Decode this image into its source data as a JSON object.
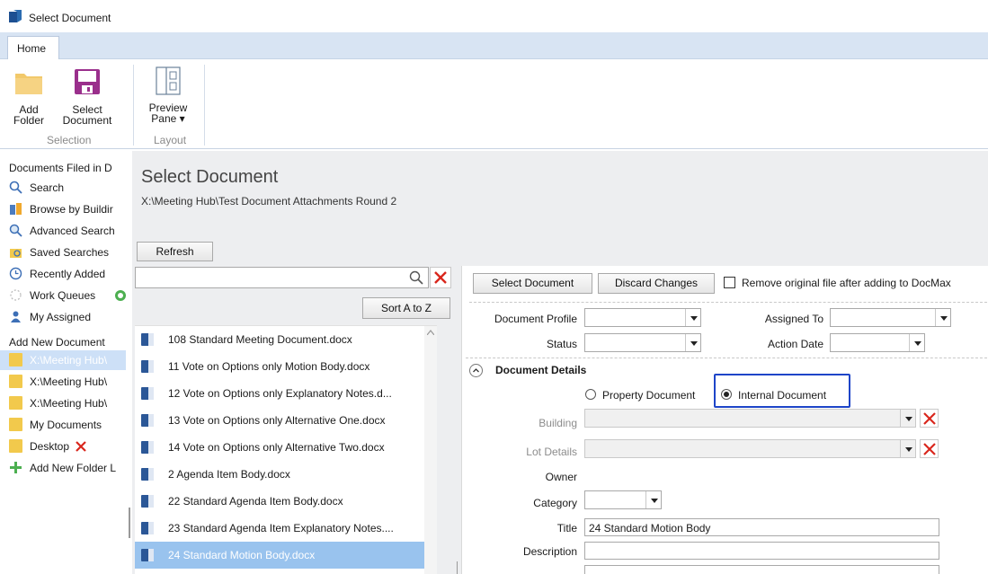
{
  "window": {
    "title": "Select Document"
  },
  "ribbon": {
    "tab": "Home",
    "add_folder": [
      "Add",
      "Folder"
    ],
    "select_document": [
      "Select",
      "Document"
    ],
    "preview_pane": [
      "Preview",
      "Pane ▾"
    ],
    "group_selection": "Selection",
    "group_layout": "Layout"
  },
  "nav": {
    "section_filed": "Documents Filed in D",
    "items": [
      {
        "label": "Search",
        "icon": "search-icon"
      },
      {
        "label": "Browse by Buildir",
        "icon": "building-icon"
      },
      {
        "label": "Advanced Search",
        "icon": "advanced-search-icon"
      },
      {
        "label": "Saved Searches",
        "icon": "saved-search-icon"
      },
      {
        "label": "Recently Added",
        "icon": "clock-icon"
      },
      {
        "label": "Work Queues",
        "icon": "queue-icon"
      },
      {
        "label": "My Assigned",
        "icon": "user-icon"
      }
    ],
    "section_add": "Add New Document",
    "folders": [
      {
        "label": "X:\\Meeting Hub\\",
        "selected": true
      },
      {
        "label": "X:\\Meeting Hub\\"
      },
      {
        "label": "X:\\Meeting Hub\\"
      },
      {
        "label": "My Documents"
      },
      {
        "label": "Desktop"
      }
    ],
    "add_folder_link": "Add New Folder L"
  },
  "main": {
    "heading": "Select Document",
    "path": "X:\\Meeting Hub\\Test Document Attachments Round 2",
    "refresh": "Refresh",
    "search_value": "",
    "sort": "Sort A to Z"
  },
  "documents": [
    "108 Standard Meeting Document.docx",
    "11 Vote on Options only Motion Body.docx",
    "12 Vote on Options only Explanatory Notes.d...",
    "13 Vote on Options only Alternative One.docx",
    "14 Vote on Options only Alternative Two.docx",
    "2 Agenda Item Body.docx",
    "22 Standard Agenda Item Body.docx",
    "23 Standard Agenda Item Explanatory Notes....",
    "24 Standard Motion Body.docx"
  ],
  "selected_document_index": 8,
  "detail": {
    "select_document": "Select Document",
    "discard_changes": "Discard Changes",
    "remove_original": "Remove original file after adding to DocMax",
    "document_profile": "Document Profile",
    "assigned_to": "Assigned To",
    "status": "Status",
    "action_date": "Action Date",
    "section_title": "Document Details",
    "property_document": "Property Document",
    "internal_document": "Internal Document",
    "building": "Building",
    "lot_details": "Lot Details",
    "owner": "Owner",
    "category": "Category",
    "title_label": "Title",
    "title_value": "24 Standard Motion Body",
    "description": "Description"
  },
  "colors": {
    "accent": "#1e45c8",
    "selected_row": "#99c3ee",
    "ribbon_tab_bar": "#d8e4f3",
    "close_red": "#d9261c"
  }
}
